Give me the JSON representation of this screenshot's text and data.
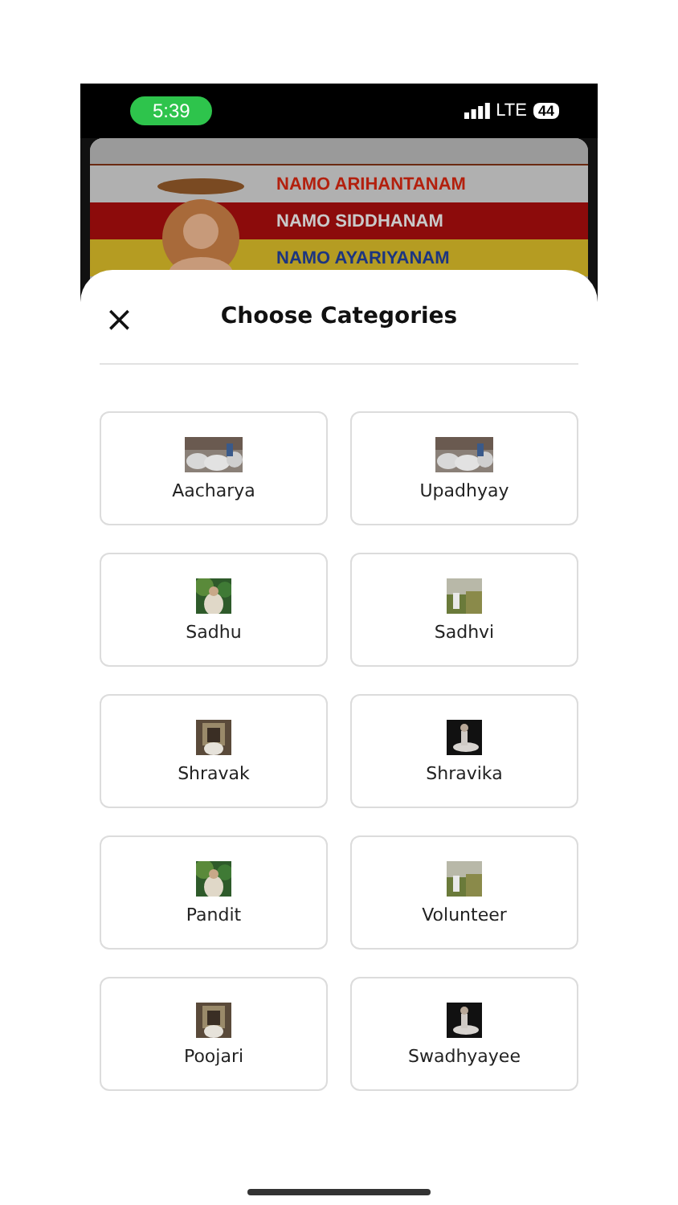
{
  "status_bar": {
    "time": "5:39",
    "network": "LTE",
    "battery": "44"
  },
  "banner": {
    "lines": [
      {
        "text": "NAMO ARIHANTANAM",
        "color": "#b0b0b0"
      },
      {
        "text": "NAMO SIDDHANAM",
        "color": "#8c0b0b"
      },
      {
        "text": "NAMO AYARIYANAM",
        "color": "#b59c22"
      }
    ]
  },
  "sheet": {
    "close": "×",
    "title": "Choose Categories",
    "categories": [
      {
        "label": "Aacharya",
        "kind": "picture"
      },
      {
        "label": "Upadhyay",
        "kind": "picture"
      },
      {
        "label": "Sadhu",
        "kind": "picture"
      },
      {
        "label": "Sadhvi",
        "kind": "picture"
      },
      {
        "label": "Shravak",
        "kind": "picture"
      },
      {
        "label": "Shravika",
        "kind": "picture"
      },
      {
        "label": "Pandit",
        "kind": "picture"
      },
      {
        "label": "Volunteer",
        "kind": "picture"
      },
      {
        "label": "Poojari",
        "kind": "picture"
      },
      {
        "label": "Swadhyayee",
        "kind": "picture"
      }
    ]
  }
}
